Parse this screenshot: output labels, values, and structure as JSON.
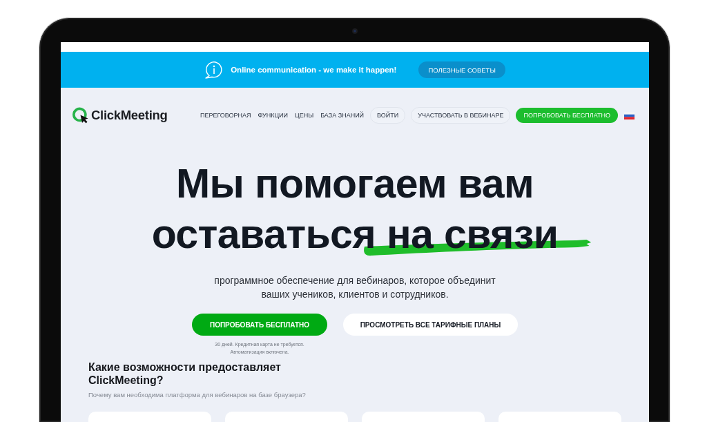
{
  "banner": {
    "message": "Online communication - we make it happen!",
    "button": "ПОЛЕЗНЫЕ СОВЕТЫ"
  },
  "nav": {
    "logo": "ClickMeeting",
    "items": [
      {
        "label": "ПЕРЕГОВОРНАЯ",
        "kind": "link"
      },
      {
        "label": "ФУНКЦИИ",
        "kind": "link"
      },
      {
        "label": "ЦЕНЫ",
        "kind": "link"
      },
      {
        "label": "БАЗА ЗНАНИЙ",
        "kind": "link"
      },
      {
        "label": "ВОЙТИ",
        "kind": "outline"
      },
      {
        "label": "УЧАСТВОВАТЬ В ВЕБИНАРЕ",
        "kind": "outline"
      },
      {
        "label": "ПОПРОБОВАТЬ БЕСПЛАТНО",
        "kind": "primary"
      }
    ]
  },
  "hero": {
    "title": [
      {
        "text": "Мы помогаем вам оставаться",
        "highlighted": false
      },
      {
        "text": "на связи",
        "highlighted": true
      }
    ],
    "subtitle": "программное обеспечение для вебинаров, которое объединит ваших учеников, клиентов и сотрудников.",
    "buttons": [
      {
        "label": "ПОПРОБОВАТЬ БЕСПЛАТНО",
        "kind": "primary"
      },
      {
        "label": "ПРОСМОТРЕТЬ ВСЕ ТАРИФНЫЕ ПЛАНЫ",
        "kind": "secondary"
      }
    ],
    "note": [
      "30 дней. Кредитная карта не требуется.",
      "Автоматизация включена."
    ]
  },
  "features": {
    "heading": "Какие возможности предоставляет ClickMeeting?",
    "subheading": "Почему вам необходима платформа для вебинаров на базе браузера?"
  }
}
